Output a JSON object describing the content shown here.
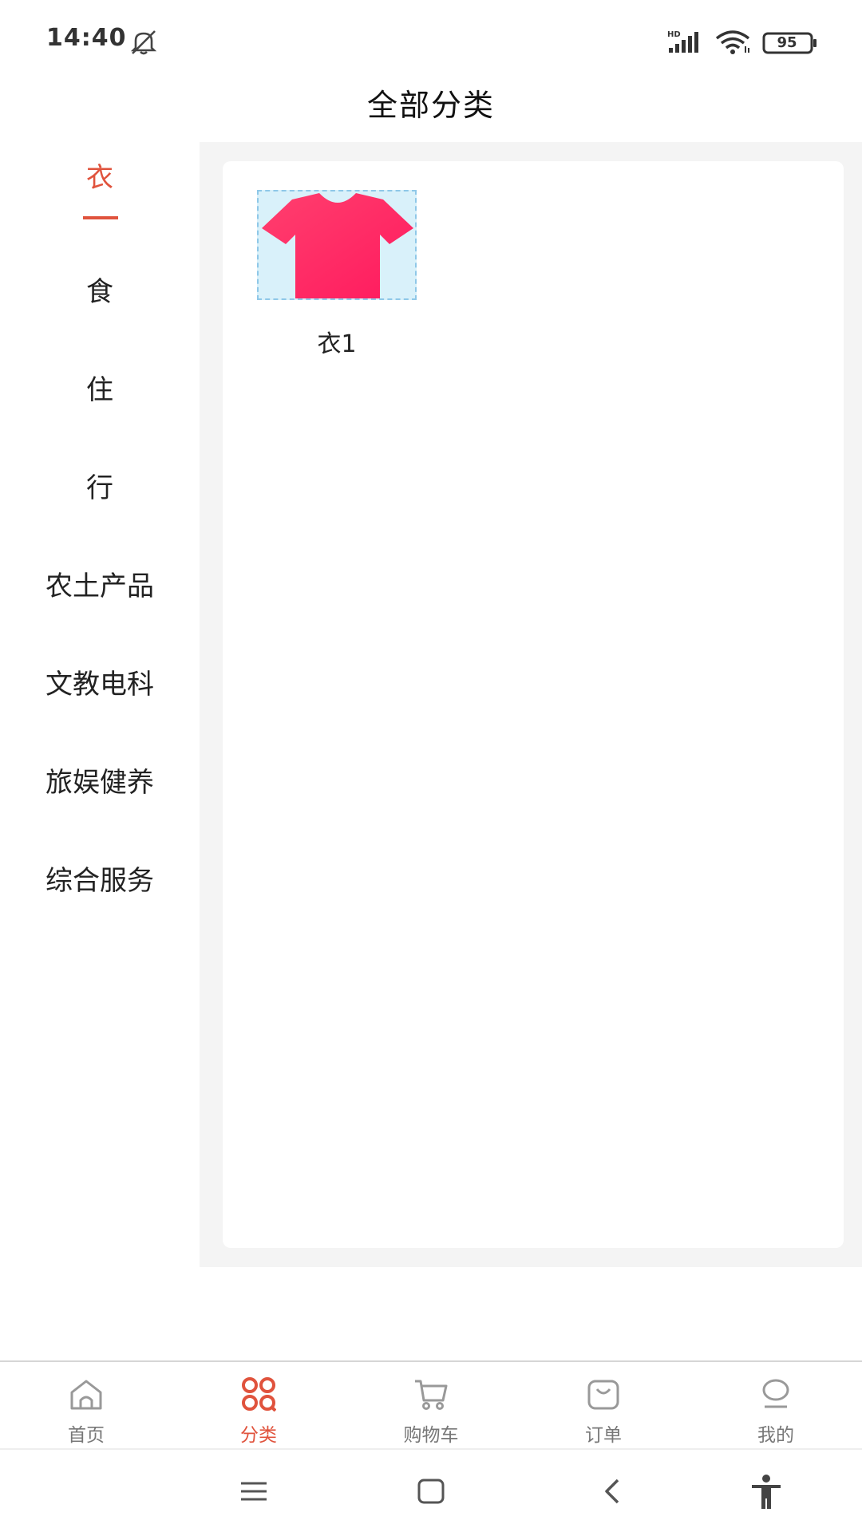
{
  "status_bar": {
    "time": "14:40",
    "battery": "95",
    "icons": [
      "bell-off-icon",
      "hd-signal-icon",
      "wifi-icon",
      "battery-icon"
    ]
  },
  "header": {
    "title": "全部分类"
  },
  "categories": {
    "active_index": 0,
    "items": [
      {
        "label": "衣"
      },
      {
        "label": "食"
      },
      {
        "label": "住"
      },
      {
        "label": "行"
      },
      {
        "label": "农土产品"
      },
      {
        "label": "文教电科"
      },
      {
        "label": "旅娱健养"
      },
      {
        "label": "综合服务"
      }
    ]
  },
  "products": [
    {
      "name": "衣1",
      "icon": "tshirt-icon"
    }
  ],
  "tab_bar": {
    "items": [
      {
        "label": "首页",
        "icon": "home-icon"
      },
      {
        "label": "分类",
        "icon": "category-grid-icon"
      },
      {
        "label": "购物车",
        "icon": "cart-icon"
      },
      {
        "label": "订单",
        "icon": "order-bag-icon"
      },
      {
        "label": "我的",
        "icon": "profile-icon"
      }
    ],
    "active_index": 1
  },
  "colors": {
    "accent": "#e0533d",
    "shirt": "#ff2a66",
    "content_bg": "#f4f4f4"
  }
}
